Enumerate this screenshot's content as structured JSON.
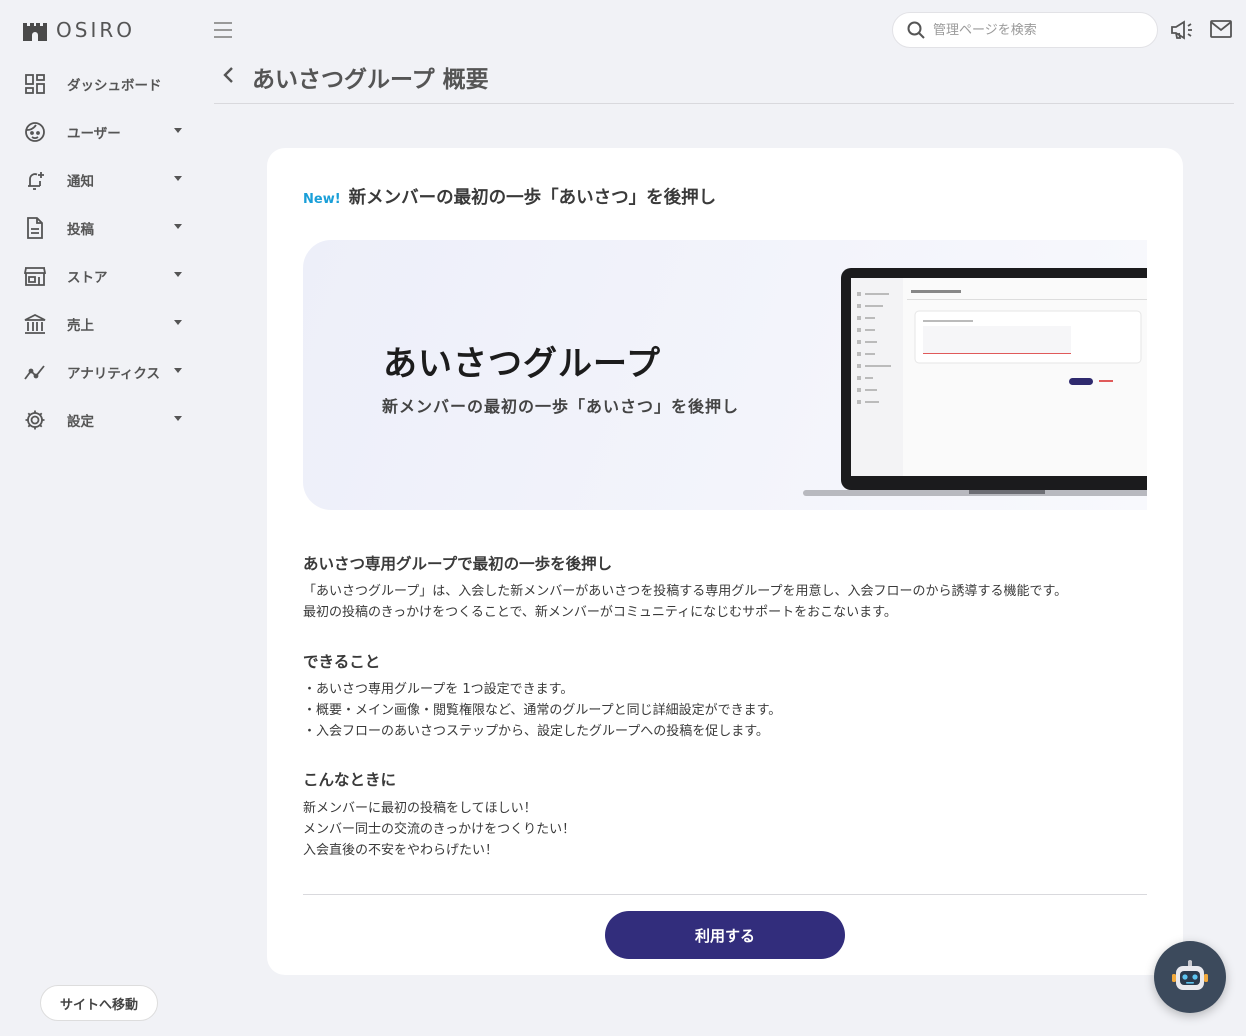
{
  "brand": {
    "name": "OSIRO"
  },
  "sidebar": {
    "items": [
      {
        "label": "ダッシュボード",
        "icon": "dashboard-icon"
      },
      {
        "label": "ユーザー",
        "icon": "user-face-icon"
      },
      {
        "label": "通知",
        "icon": "bell-add-icon"
      },
      {
        "label": "投稿",
        "icon": "document-icon"
      },
      {
        "label": "ストア",
        "icon": "store-icon"
      },
      {
        "label": "売上",
        "icon": "bank-icon"
      },
      {
        "label": "アナリティクス",
        "icon": "analytics-icon"
      },
      {
        "label": "設定",
        "icon": "gear-icon"
      }
    ],
    "site_button": "サイトへ移動"
  },
  "topbar": {
    "search_placeholder": "管理ページを検索"
  },
  "page": {
    "title": "あいさつグループ 概要"
  },
  "card": {
    "new_badge": "New!",
    "headline": "新メンバーの最初の一歩「あいさつ」を後押し",
    "hero": {
      "title": "あいさつグループ",
      "subtitle": "新メンバーの最初の一歩「あいさつ」を後押し"
    },
    "section1": {
      "title": "あいさつ専用グループで最初の一歩を後押し",
      "lines": [
        "「あいさつグループ」は、入会した新メンバーがあいさつを投稿する専用グループを用意し、入会フローのから誘導する機能です。",
        "最初の投稿のきっかけをつくることで、新メンバーがコミュニティになじむサポートをおこないます。"
      ]
    },
    "section2": {
      "title": "できること",
      "lines": [
        "・あいさつ専用グループを 1つ設定できます。",
        "・概要・メイン画像・閲覧権限など、通常のグループと同じ詳細設定ができます。",
        "・入会フローのあいさつステップから、設定したグループへの投稿を促します。"
      ]
    },
    "section3": {
      "title": "こんなときに",
      "lines": [
        "新メンバーに最初の投稿をしてほしい！",
        "メンバー同士の交流のきっかけをつくりたい！",
        "入会直後の不安をやわらげたい！"
      ]
    },
    "use_button": "利用する"
  },
  "colors": {
    "accent": "#322d7c",
    "new_badge": "#1a9fd8",
    "page_bg": "#f1f2f6"
  }
}
